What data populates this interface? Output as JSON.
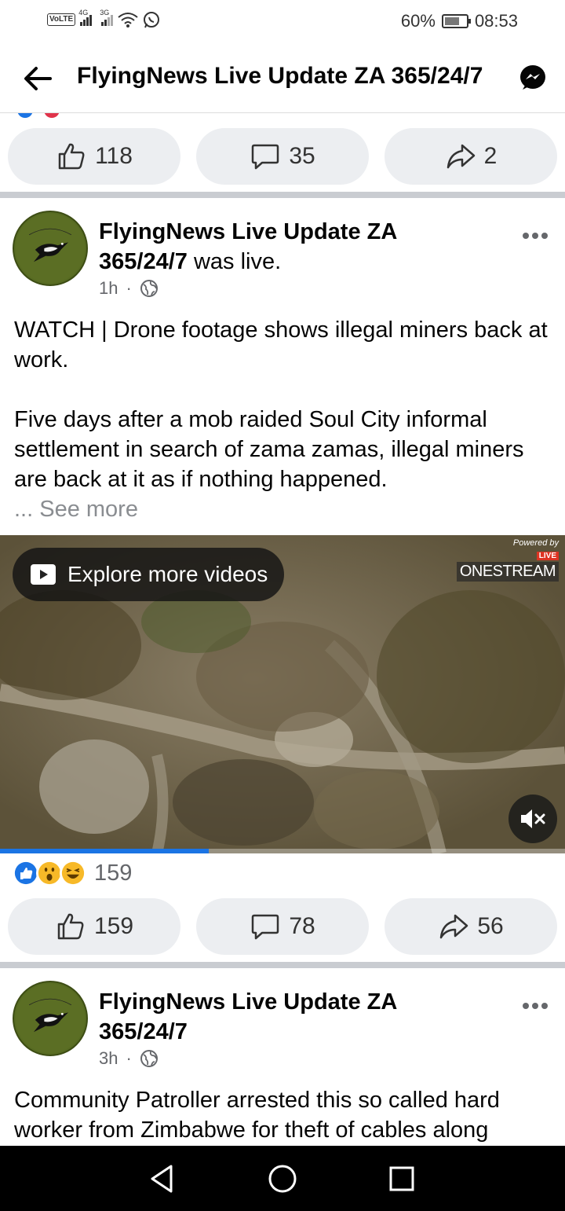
{
  "status_bar": {
    "volte": "VoLTE",
    "net1": "4G",
    "net2": "3G",
    "battery": "60%",
    "time": "08:53"
  },
  "header": {
    "title": "FlyingNews Live Update ZA 365/24/7"
  },
  "top_actions": {
    "like_count": "118",
    "comment_count": "35",
    "share_count": "2"
  },
  "posts": [
    {
      "author": "FlyingNews Live Update ZA 365/24/7",
      "author_suffix": " was live.",
      "time": "1h",
      "text_line1": "WATCH | Drone footage  shows illegal miners back at work.",
      "text_line2": "Five days after a mob raided Soul City informal settlement in search of zama zamas, illegal miners are back at it as if nothing happened.",
      "see_more": "... See more",
      "video": {
        "explore_label": "Explore more videos",
        "powered_by": "Powered by",
        "live": "LIVE",
        "brand": "ONESTREAM",
        "progress": 0.37
      },
      "reactions_count": "159",
      "like_count": "159",
      "comment_count": "78",
      "share_count": "56"
    },
    {
      "author": "FlyingNews Live Update ZA 365/24/7",
      "time": "3h",
      "text": "Community Patroller arrested this so called hard worker from Zimbabwe for theft of cables along"
    }
  ],
  "colors": {
    "accent": "#1b74e4",
    "button_bg": "#eceef1",
    "separator": "#c9ccd1",
    "muted_text": "#65676b"
  }
}
